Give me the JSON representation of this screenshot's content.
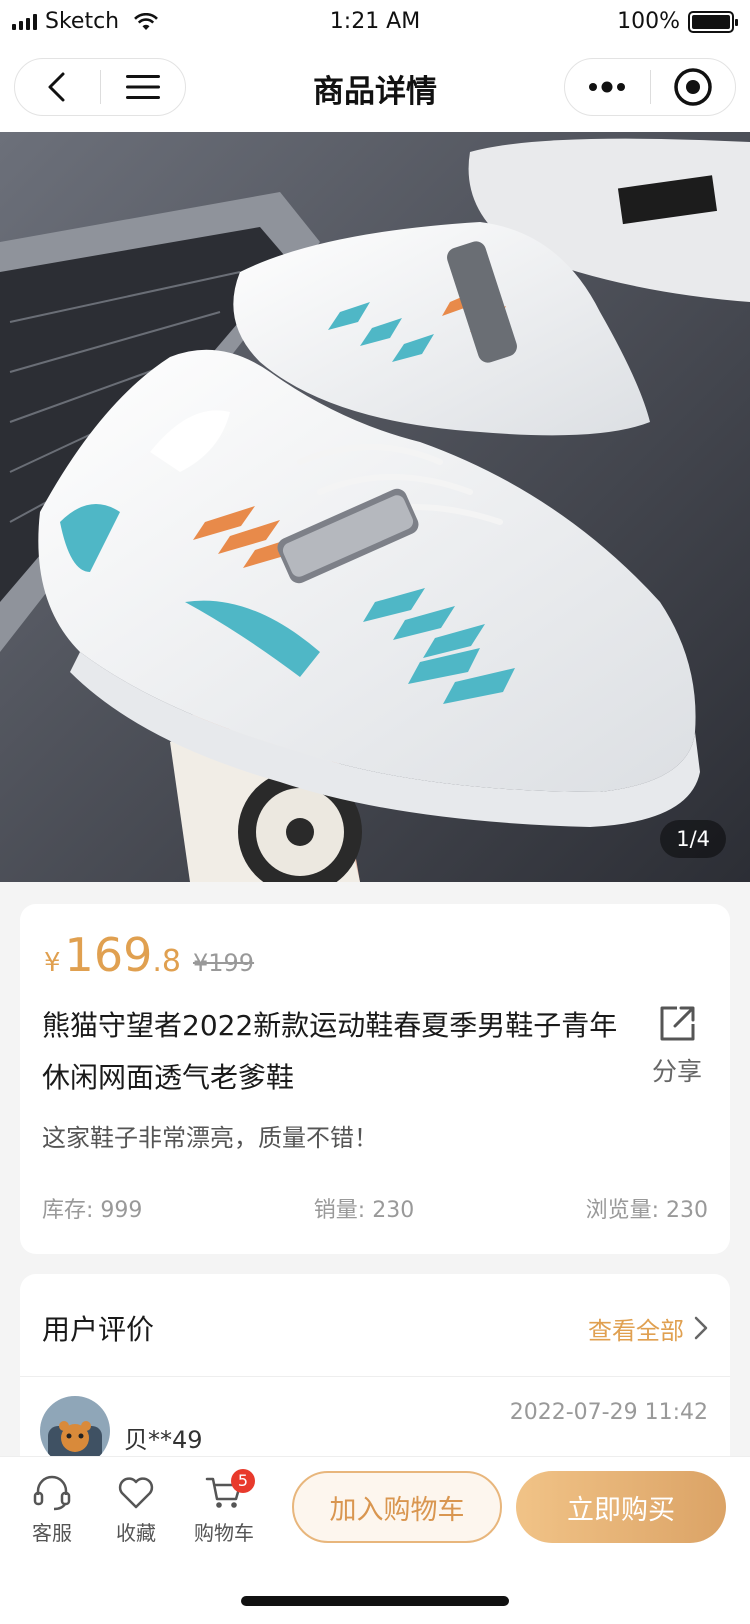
{
  "status_bar": {
    "carrier": "Sketch",
    "time": "1:21 AM",
    "battery": "100%",
    "battery_level": 1.0
  },
  "navbar": {
    "title": "商品详情"
  },
  "hero": {
    "page_indicator": "1/4"
  },
  "product": {
    "currency": "¥",
    "price_int": "169",
    "price_dec": ".8",
    "original_price": "¥199",
    "title": "熊猫守望者2022新款运动鞋春夏季男鞋子青年休闲网面透气老爹鞋",
    "share_label": "分享",
    "description": "这家鞋子非常漂亮，质量不错！",
    "stock": "库存: 999",
    "sales": "销量: 230",
    "views": "浏览量: 230"
  },
  "reviews": {
    "title": "用户评价",
    "view_all": "查看全部",
    "items": [
      {
        "user": "贝**49",
        "date": "2022-07-29 11:42"
      }
    ]
  },
  "bottom_bar": {
    "service_label": "客服",
    "favorite_label": "收藏",
    "cart_label": "购物车",
    "cart_count": "5",
    "add_to_cart": "加入购物车",
    "buy_now": "立即购买"
  },
  "colors": {
    "accent": "#e0a050",
    "badge": "#e83a2c"
  }
}
